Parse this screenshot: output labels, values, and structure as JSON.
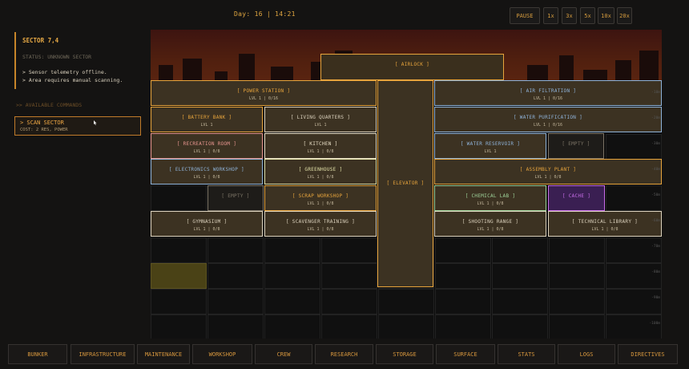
{
  "topbar": {
    "day": "Day: 16 | 14:21",
    "speed": [
      "PAUSE",
      "1x",
      "3x",
      "5x",
      "10x",
      "20x"
    ]
  },
  "left": {
    "title": "SECTOR 7,4",
    "status": "STATUS: UNKNOWN SECTOR",
    "lines": [
      "> Sensor telemetry offline.",
      "> Area requires manual scanning."
    ],
    "commands_header": ">> AVAILABLE COMMANDS",
    "scan": {
      "label": "> SCAN SECTOR",
      "cost": "COST: 2 RES, POWER"
    }
  },
  "rooms": [
    {
      "name": "[ AIRLOCK ]",
      "lvl": "",
      "color": "#e7a43c"
    },
    {
      "name": "[ POWER STATION ]",
      "lvl": "LVL 1 | 0/16",
      "color": "#e7a43c"
    },
    {
      "name": "[ AIR FILTRATION ]",
      "lvl": "LVL 1 | 0/16",
      "color": "#8fb3d9"
    },
    {
      "name": "[ BATTERY BANK ]",
      "lvl": "LVL 1",
      "color": "#e7a43c"
    },
    {
      "name": "[ LIVING QUARTERS ]",
      "lvl": "LVL 1",
      "color": "#dcd2bd"
    },
    {
      "name": "[ WATER PURIFICATION ]",
      "lvl": "LVL 1 | 0/16",
      "color": "#8fb3d9"
    },
    {
      "name": "[ RECREATION ROOM ]",
      "lvl": "LVL 1 | 0/8",
      "color": "#e8968f"
    },
    {
      "name": "[ KITCHEN ]",
      "lvl": "LVL 1 | 0/8",
      "color": "#e9dfc6"
    },
    {
      "name": "[ WATER RESERVOIR ]",
      "lvl": "LVL 1",
      "color": "#8fb3d9"
    },
    {
      "name": "[ EMPTY ]",
      "lvl": "",
      "color": "#7c7466"
    },
    {
      "name": "[ ELECTRONICS WORKSHOP ]",
      "lvl": "LVL 1 | 0/8",
      "color": "#8fb3d9"
    },
    {
      "name": "[ GREENHOUSE ]",
      "lvl": "LVL 1 | 0/8",
      "color": "#e3e2a8"
    },
    {
      "name": "[ ELEVATOR ]",
      "lvl": "",
      "color": "#e7a43c"
    },
    {
      "name": "[ ASSEMBLY PLANT ]",
      "lvl": "LVL 1 | 0/8",
      "color": "#e7a43c"
    },
    {
      "name": "[ EMPTY ]",
      "lvl": "",
      "color": "#7c7466"
    },
    {
      "name": "[ SCRAP WORKSHOP ]",
      "lvl": "LVL 1 | 0/8",
      "color": "#e7a43c"
    },
    {
      "name": "[ CHEMICAL LAB ]",
      "lvl": "LVL 1 | 0/8",
      "color": "#9fd49a"
    },
    {
      "name": "[ CACHE ]",
      "lvl": "",
      "color": "#c76de8"
    },
    {
      "name": "[ GYMNASIUM ]",
      "lvl": "LVL 1 | 0/8",
      "color": "#dcd2bd"
    },
    {
      "name": "[ SCAVENGER TRAINING ]",
      "lvl": "LVL 1 | 0/8",
      "color": "#dcd2bd"
    },
    {
      "name": "[ SHOOTING RANGE ]",
      "lvl": "LVL 1 | 0/8",
      "color": "#dcd2bd"
    },
    {
      "name": "[ TECHNICAL LIBRARY ]",
      "lvl": "LVL 1 | 0/8",
      "color": "#dcd2bd"
    }
  ],
  "depths": [
    "-10m",
    "-20m",
    "-30m",
    "-40m",
    "-50m",
    "-60m",
    "-70m",
    "-80m",
    "-90m",
    "-100m"
  ],
  "nav": [
    "BUNKER",
    "INFRASTRUCTURE",
    "MAINTENANCE",
    "WORKSHOP",
    "CREW",
    "RESEARCH",
    "STORAGE",
    "SURFACE",
    "STATS",
    "LOGS",
    "DIRECTIVES"
  ]
}
